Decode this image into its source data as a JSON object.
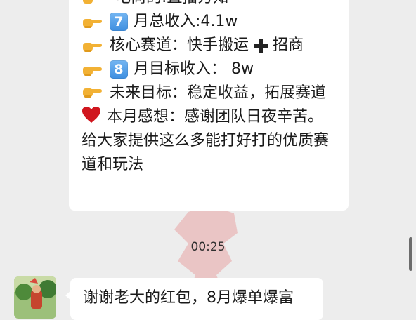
{
  "message": {
    "line0": "-电商的:直播方知",
    "line1_key": "7",
    "line1_text": "月总收入:4.1w",
    "line2_a": "核心赛道：快手搬运",
    "line2_b": "招商",
    "line3_key": "8",
    "line3_text": "月目标收入：  8w",
    "line4": "未来目标：稳定收益，拓展赛道",
    "line5": "本月感想：感谢团队日夜辛苦。给大家提供这么多能打好打的优质赛道和玩法"
  },
  "timestamp": "00:25",
  "reply": {
    "text": "谢谢老大的红包，8月爆单爆富"
  },
  "colors": {
    "background": "#ededed",
    "bubble": "#ffffff",
    "keycap": "#3f8fe0",
    "heart": "#d0161e",
    "hand": "#f2b134"
  },
  "icons": [
    "pointing-hand-icon",
    "keycap-7-icon",
    "keycap-8-icon",
    "plus-icon",
    "red-heart-icon"
  ]
}
